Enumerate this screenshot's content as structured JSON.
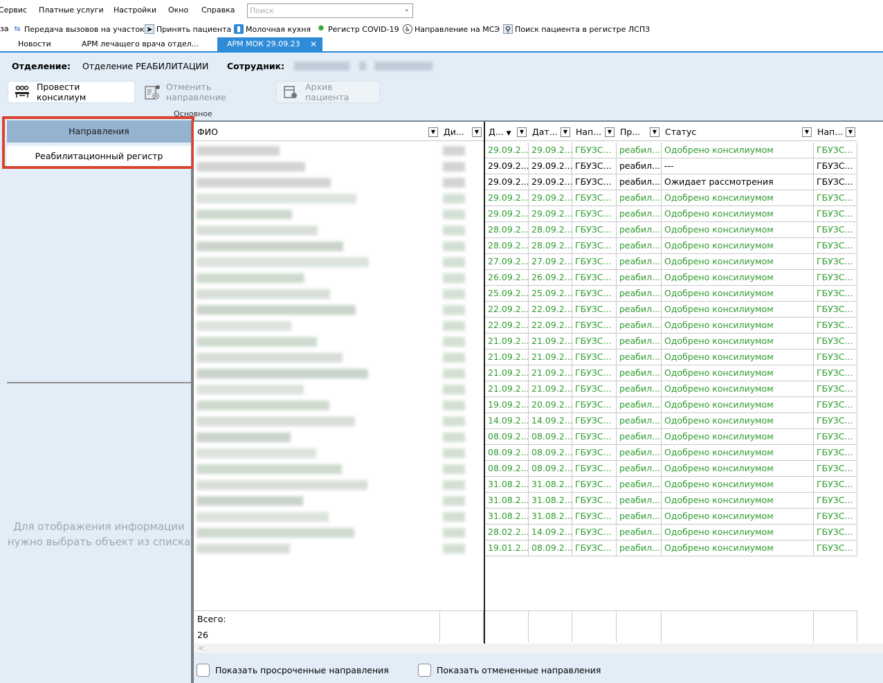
{
  "menu": {
    "items": [
      "Сервис",
      "Платные услуги",
      "Настройки",
      "Окно",
      "Справка"
    ],
    "search_placeholder": "Поиск"
  },
  "quickbar": {
    "items": [
      {
        "label": "Передача вызовов на участок",
        "icon": "transfer-icon"
      },
      {
        "label": "Принять пациента",
        "icon": "accept-patient-icon"
      },
      {
        "label": "Молочная кухня",
        "icon": "milk-kitchen-icon"
      },
      {
        "label": "Регистр COVID-19",
        "icon": "covid-icon"
      },
      {
        "label": "Направление на МСЭ",
        "icon": "mse-icon"
      },
      {
        "label": "Поиск пациента в регистре ЛСПЗ",
        "icon": "search-patient-icon"
      }
    ],
    "leading_fragment": "за"
  },
  "tabs": [
    {
      "label": "Новости"
    },
    {
      "label": "АРМ лечащего врача отдел..."
    },
    {
      "label": "АРМ МОК 29.09.23",
      "active": true
    }
  ],
  "header": {
    "department_label": "Отделение:",
    "department_value": "Отделение РЕАБИЛИТАЦИИ",
    "employee_label": "Сотрудник:"
  },
  "toolbar": {
    "consilium": "Провести консилиум",
    "cancel_direction": "Отменить направление",
    "patient_archive": "Архив пациента",
    "group_label": "Основное"
  },
  "leftnav": {
    "items": [
      "Направления",
      "Реабилитационный регистр"
    ],
    "placeholder": "Для отображения информации нужно выбрать объект из списка"
  },
  "grid": {
    "columns": [
      "ФИО",
      "Ди...",
      "Д...",
      "Дат...",
      "Нап...",
      "Пр...",
      "Статус",
      "Нап..."
    ],
    "rows": [
      [
        "29.09.2...",
        "29.09.2...",
        "ГБУЗС...",
        "реабил...",
        "Одобрено консилиумом",
        "ГБУЗС...",
        "green"
      ],
      [
        "29.09.2...",
        "29.09.2...",
        "ГБУЗС...",
        "реабил...",
        "---",
        "ГБУЗС...",
        "black"
      ],
      [
        "29.09.2...",
        "29.09.2...",
        "ГБУЗС...",
        "реабил...",
        "Ожидает рассмотрения",
        "ГБУЗС...",
        "black"
      ],
      [
        "29.09.2...",
        "29.09.2...",
        "ГБУЗС...",
        "реабил...",
        "Одобрено консилиумом",
        "ГБУЗС...",
        "green"
      ],
      [
        "29.09.2...",
        "29.09.2...",
        "ГБУЗС...",
        "реабил...",
        "Одобрено консилиумом",
        "ГБУЗС...",
        "green"
      ],
      [
        "28.09.2...",
        "28.09.2...",
        "ГБУЗС...",
        "реабил...",
        "Одобрено консилиумом",
        "ГБУЗС...",
        "green"
      ],
      [
        "28.09.2...",
        "28.09.2...",
        "ГБУЗС...",
        "реабил...",
        "Одобрено консилиумом",
        "ГБУЗС...",
        "green"
      ],
      [
        "27.09.2...",
        "27.09.2...",
        "ГБУЗС...",
        "реабил...",
        "Одобрено консилиумом",
        "ГБУЗС...",
        "green"
      ],
      [
        "26.09.2...",
        "26.09.2...",
        "ГБУЗС...",
        "реабил...",
        "Одобрено консилиумом",
        "ГБУЗС...",
        "green"
      ],
      [
        "25.09.2...",
        "25.09.2...",
        "ГБУЗС...",
        "реабил...",
        "Одобрено консилиумом",
        "ГБУЗС...",
        "green"
      ],
      [
        "22.09.2...",
        "22.09.2...",
        "ГБУЗС...",
        "реабил...",
        "Одобрено консилиумом",
        "ГБУЗС...",
        "green"
      ],
      [
        "22.09.2...",
        "22.09.2...",
        "ГБУЗС...",
        "реабил...",
        "Одобрено консилиумом",
        "ГБУЗС...",
        "green"
      ],
      [
        "21.09.2...",
        "21.09.2...",
        "ГБУЗС...",
        "реабил...",
        "Одобрено консилиумом",
        "ГБУЗС...",
        "green"
      ],
      [
        "21.09.2...",
        "21.09.2...",
        "ГБУЗС...",
        "реабил...",
        "Одобрено консилиумом",
        "ГБУЗС...",
        "green"
      ],
      [
        "21.09.2...",
        "21.09.2...",
        "ГБУЗС...",
        "реабил...",
        "Одобрено консилиумом",
        "ГБУЗС...",
        "green"
      ],
      [
        "21.09.2...",
        "21.09.2...",
        "ГБУЗС...",
        "реабил...",
        "Одобрено консилиумом",
        "ГБУЗС...",
        "green"
      ],
      [
        "19.09.2...",
        "20.09.2...",
        "ГБУЗС...",
        "реабил...",
        "Одобрено консилиумом",
        "ГБУЗС...",
        "green"
      ],
      [
        "14.09.2...",
        "14.09.2...",
        "ГБУЗС...",
        "реабил...",
        "Одобрено консилиумом",
        "ГБУЗС...",
        "green"
      ],
      [
        "08.09.2...",
        "08.09.2...",
        "ГБУЗС...",
        "реабил...",
        "Одобрено консилиумом",
        "ГБУЗС...",
        "green"
      ],
      [
        "08.09.2...",
        "08.09.2...",
        "ГБУЗС...",
        "реабил...",
        "Одобрено консилиумом",
        "ГБУЗС...",
        "green"
      ],
      [
        "08.09.2...",
        "08.09.2...",
        "ГБУЗС...",
        "реабил...",
        "Одобрено консилиумом",
        "ГБУЗС...",
        "green"
      ],
      [
        "31.08.2...",
        "31.08.2...",
        "ГБУЗС...",
        "реабил...",
        "Одобрено консилиумом",
        "ГБУЗС...",
        "green"
      ],
      [
        "31.08.2...",
        "31.08.2...",
        "ГБУЗС...",
        "реабил...",
        "Одобрено консилиумом",
        "ГБУЗС...",
        "green"
      ],
      [
        "31.08.2...",
        "31.08.2...",
        "ГБУЗС...",
        "реабил...",
        "Одобрено консилиумом",
        "ГБУЗС...",
        "green"
      ],
      [
        "28.02.2...",
        "14.09.2...",
        "ГБУЗС...",
        "реабил...",
        "Одобрено консилиумом",
        "ГБУЗС...",
        "green"
      ],
      [
        "19.01.2...",
        "08.09.2...",
        "ГБУЗС...",
        "реабил...",
        "Одобрено консилиумом",
        "ГБУЗС...",
        "green"
      ]
    ],
    "total_label": "Всего:",
    "total_value": "26",
    "scroll_glyph": "<"
  },
  "bottom": {
    "show_overdue": "Показать просроченные направления",
    "show_cancelled": "Показать отмененные направления"
  },
  "colors": {
    "accent": "#2d8bd8",
    "panel": "#e3edf7",
    "nav_selected": "#95b3d0",
    "status_green": "#2f9b2f",
    "highlight_red": "#d9432f"
  }
}
